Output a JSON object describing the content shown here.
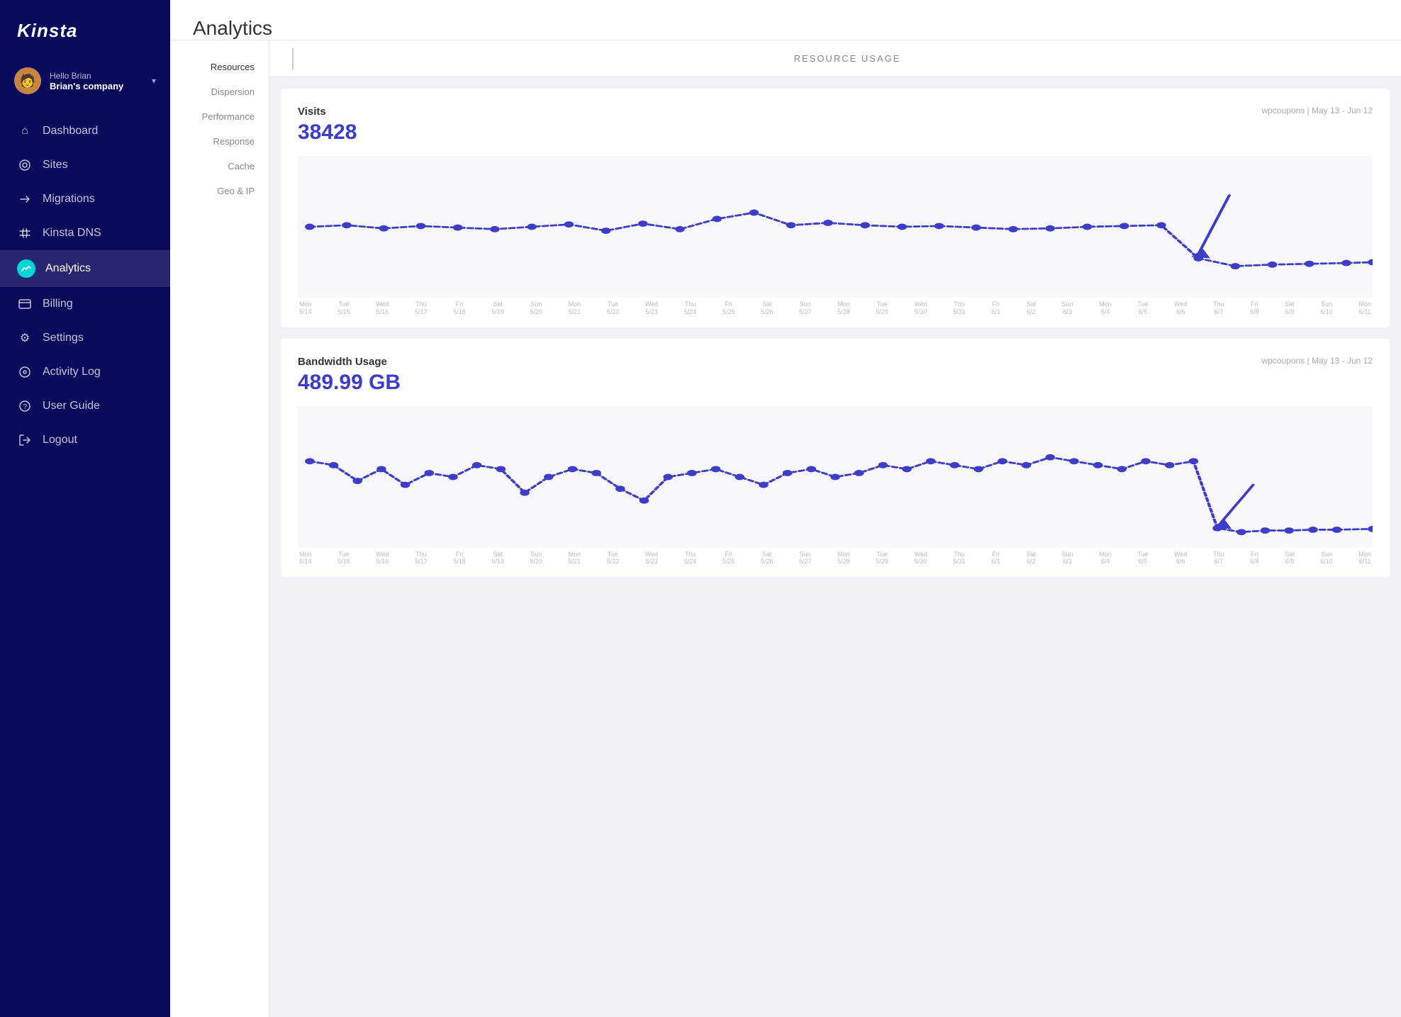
{
  "app": {
    "logo": "Kinsta"
  },
  "user": {
    "greeting": "Hello Brian",
    "company": "Brian's company",
    "avatar_emoji": "👤"
  },
  "sidebar": {
    "items": [
      {
        "id": "dashboard",
        "label": "Dashboard",
        "icon": "⌂"
      },
      {
        "id": "sites",
        "label": "Sites",
        "icon": "✦"
      },
      {
        "id": "migrations",
        "label": "Migrations",
        "icon": "→"
      },
      {
        "id": "kinsta-dns",
        "label": "Kinsta DNS",
        "icon": "⇌"
      },
      {
        "id": "analytics",
        "label": "Analytics",
        "icon": "◉",
        "active": true,
        "icon_bg": true
      },
      {
        "id": "billing",
        "label": "Billing",
        "icon": "▤"
      },
      {
        "id": "settings",
        "label": "Settings",
        "icon": "⚙"
      },
      {
        "id": "activity-log",
        "label": "Activity Log",
        "icon": "👁"
      },
      {
        "id": "user-guide",
        "label": "User Guide",
        "icon": "ℹ"
      },
      {
        "id": "logout",
        "label": "Logout",
        "icon": "↩"
      }
    ]
  },
  "page": {
    "title": "Analytics"
  },
  "subnav": {
    "items": [
      {
        "id": "resources",
        "label": "Resources",
        "active": true
      },
      {
        "id": "dispersion",
        "label": "Dispersion"
      },
      {
        "id": "performance",
        "label": "Performance"
      },
      {
        "id": "response",
        "label": "Response"
      },
      {
        "id": "cache",
        "label": "Cache"
      },
      {
        "id": "geo-ip",
        "label": "Geo & IP"
      }
    ]
  },
  "resource_header": {
    "title": "RESOURCE USAGE"
  },
  "charts": [
    {
      "id": "visits",
      "label": "Visits",
      "value": "38428",
      "meta": "wpcoupons | May 13 - Jun 12"
    },
    {
      "id": "bandwidth",
      "label": "Bandwidth Usage",
      "value": "489.99 GB",
      "meta": "wpcoupons | May 13 - Jun 12"
    }
  ],
  "x_axis_dates": [
    "Mon\n5/14",
    "Tue\n5/15",
    "Wed\n5/16",
    "Thu\n5/17",
    "Fri\n5/18",
    "Sat\n5/19",
    "Sun\n5/20",
    "Mon\n5/21",
    "Tue\n5/22",
    "Wed\n5/23",
    "Thu\n5/24",
    "Fri\n5/25",
    "Sat\n5/26",
    "Sun\n5/27",
    "Mon\n5/28",
    "Tue\n5/29",
    "Wed\n5/30",
    "Thu\n5/31",
    "Fri\n6/1",
    "Sat\n6/2",
    "Sun\n6/3",
    "Mon\n6/4",
    "Tue\n6/5",
    "Wed\n6/6",
    "Thu\n6/7",
    "Fri\n6/8",
    "Sat\n6/9",
    "Sun\n6/10",
    "Mon\n6/11"
  ],
  "colors": {
    "sidebar_bg": "#0a0a5c",
    "accent": "#3d3dc8",
    "line_color": "#3d3dc8",
    "active_icon_bg": "#00d4d4"
  }
}
